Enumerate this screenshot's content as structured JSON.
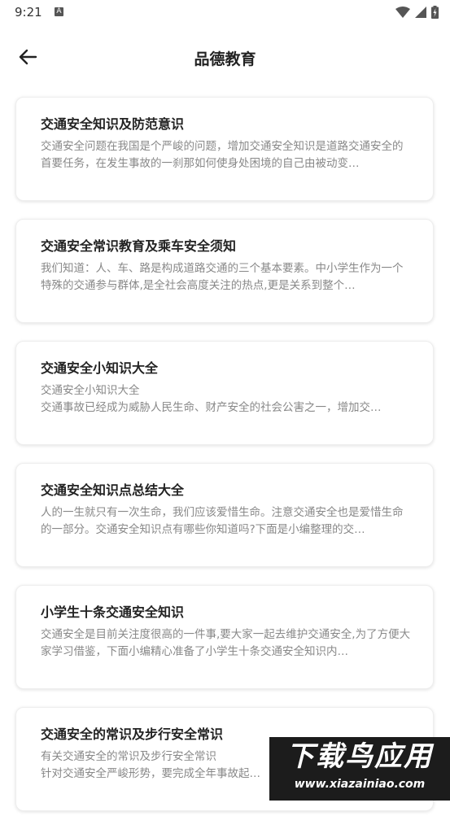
{
  "status_bar": {
    "time": "9:21",
    "notification_letter": "A"
  },
  "header": {
    "title": "品德教育"
  },
  "articles": [
    {
      "title": "交通安全知识及防范意识",
      "summary": "交通安全问题在我国是个严峻的问题，增加交通安全知识是道路交通安全的首要任务，在发生事故的一刹那如何使身处困境的自己由被动变…"
    },
    {
      "title": "交通安全常识教育及乘车安全须知",
      "summary": "我们知道：人、车、路是构成道路交通的三个基本要素。中小学生作为一个特殊的交通参与群体,是全社会高度关注的热点,更是关系到整个…"
    },
    {
      "title": "交通安全小知识大全",
      "summary": "交通安全小知识大全\n交通事故已经成为威胁人民生命、财产安全的社会公害之一，增加交…"
    },
    {
      "title": "交通安全知识点总结大全",
      "summary": "人的一生就只有一次生命，我们应该爱惜生命。注意交通安全也是爱惜生命的一部分。交通安全知识点有哪些你知道吗?下面是小编整理的交…"
    },
    {
      "title": "小学生十条交通安全知识",
      "summary": "交通安全是目前关注度很高的一件事,要大家一起去维护交通安全,为了方便大家学习借鉴，下面小编精心准备了小学生十条交通安全知识内…"
    },
    {
      "title": "交通安全的常识及步行安全常识",
      "summary": "有关交通安全的常识及步行安全常识\n针对交通安全严峻形势，要完成全年事故起…"
    }
  ],
  "watermark": {
    "title": "下载鸟应用",
    "url": "www.xiazainiao.com"
  }
}
